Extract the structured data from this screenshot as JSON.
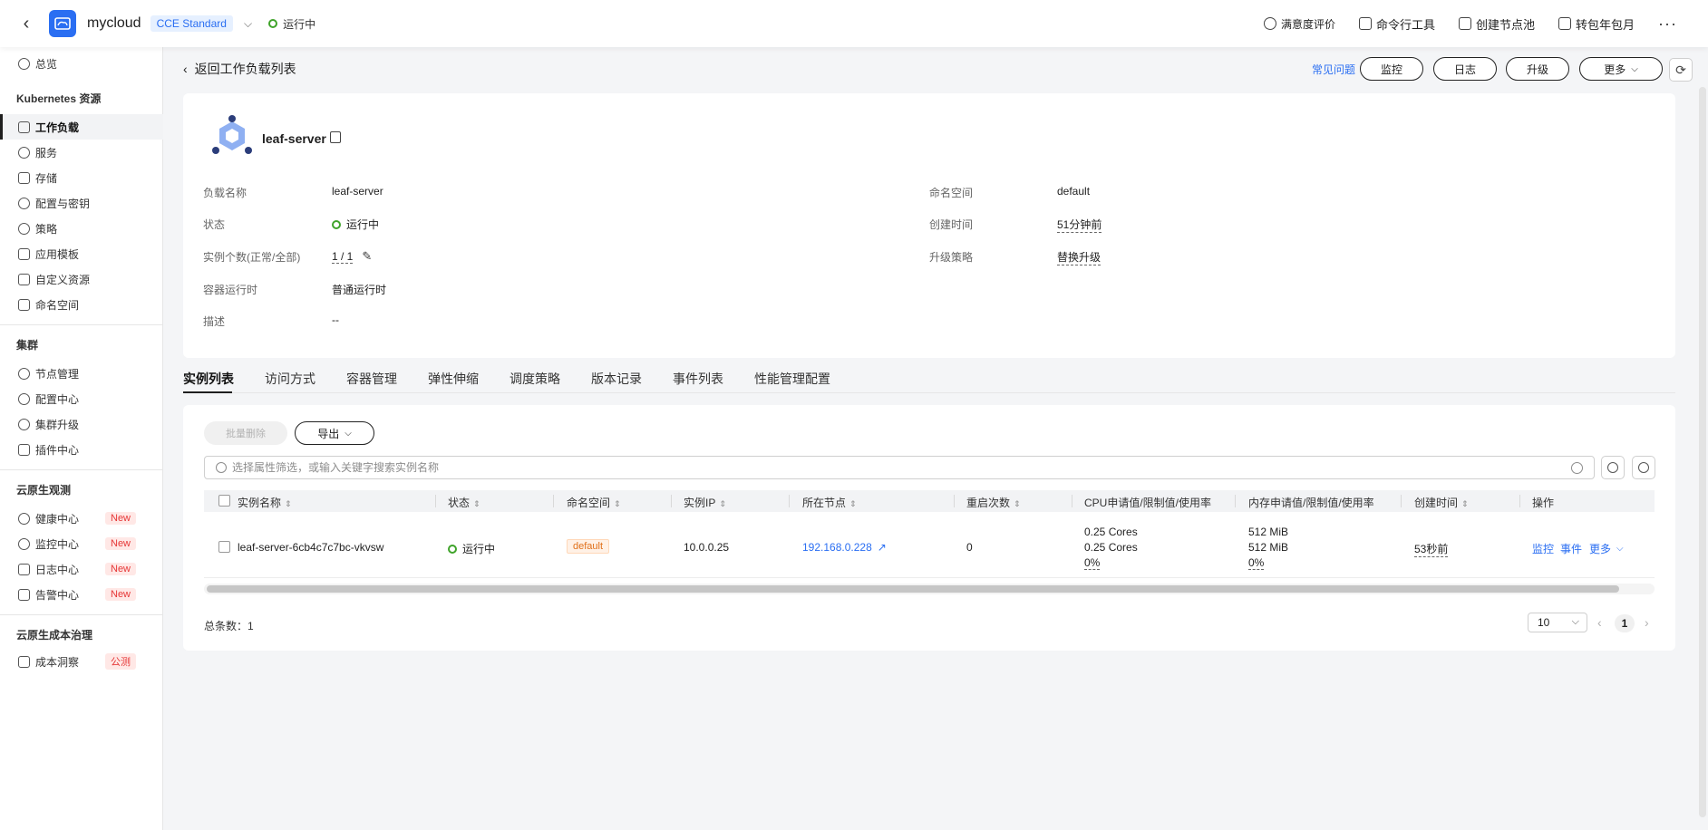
{
  "topbar": {
    "cluster_name": "mycloud",
    "edition": "CCE Standard",
    "status": "运行中",
    "actions": [
      "满意度评价",
      "命令行工具",
      "创建节点池",
      "转包年包月"
    ],
    "more": "···"
  },
  "sidebar": {
    "overview": "总览",
    "k8s_head": "Kubernetes 资源",
    "k8s_items": [
      "工作负载",
      "服务",
      "存储",
      "配置与密钥",
      "策略",
      "应用模板",
      "自定义资源",
      "命名空间"
    ],
    "cluster_head": "集群",
    "cluster_items": [
      "节点管理",
      "配置中心",
      "集群升级",
      "插件中心"
    ],
    "obs_head": "云原生观测",
    "obs_items": [
      "健康中心",
      "监控中心",
      "日志中心",
      "告警中心"
    ],
    "new_badge": "New",
    "cost_head": "云原生成本治理",
    "cost_item": "成本洞察",
    "beta_badge": "公测"
  },
  "header": {
    "back_label": "返回工作负载列表",
    "faq": "常见问题",
    "buttons": [
      "监控",
      "日志",
      "升级",
      "更多"
    ]
  },
  "workload": {
    "name": "leaf-server",
    "fields_left": [
      {
        "k": "负载名称",
        "v": "leaf-server"
      },
      {
        "k": "状态",
        "v": "运行中"
      },
      {
        "k": "实例个数(正常/全部)",
        "v": "1 / 1"
      },
      {
        "k": "容器运行时",
        "v": "普通运行时"
      },
      {
        "k": "描述",
        "v": "--"
      }
    ],
    "fields_right": [
      {
        "k": "命名空间",
        "v": "default"
      },
      {
        "k": "创建时间",
        "v": "51分钟前"
      },
      {
        "k": "升级策略",
        "v": "替换升级"
      }
    ]
  },
  "tabs": [
    "实例列表",
    "访问方式",
    "容器管理",
    "弹性伸缩",
    "调度策略",
    "版本记录",
    "事件列表",
    "性能管理配置"
  ],
  "toolbar": {
    "batch_delete": "批量删除",
    "export": "导出",
    "search_placeholder": "选择属性筛选，或输入关键字搜索实例名称"
  },
  "table": {
    "columns": [
      "实例名称",
      "状态",
      "命名空间",
      "实例IP",
      "所在节点",
      "重启次数",
      "CPU申请值/限制值/使用率",
      "内存申请值/限制值/使用率",
      "创建时间",
      "操作"
    ],
    "row": {
      "name": "leaf-server-6cb4c7c7bc-vkvsw",
      "status": "运行中",
      "namespace": "default",
      "ip": "10.0.0.25",
      "node": "192.168.0.228",
      "restarts": "0",
      "cpu": [
        "0.25 Cores",
        "0.25 Cores",
        "0%"
      ],
      "mem": [
        "512 MiB",
        "512 MiB",
        "0%"
      ],
      "created": "53秒前",
      "ops": [
        "监控",
        "事件",
        "更多"
      ]
    }
  },
  "footer": {
    "total": "总条数：1",
    "page_size": "10",
    "page": "1"
  },
  "colors": {
    "accent": "#2a6ef2",
    "success": "#3fa32a",
    "danger": "#e63737",
    "tag_orange": "#e0701a"
  }
}
